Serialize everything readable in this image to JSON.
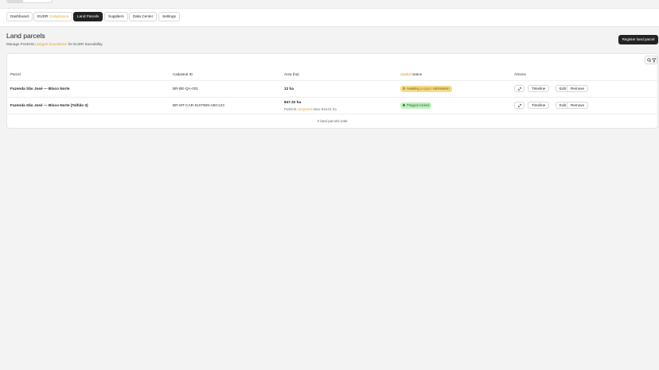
{
  "nav": {
    "dashboard": "Dashboard",
    "eudr_prefix": "EUDR",
    "eudr_highlight": "Compliance",
    "land_parcels": "Land Parcels",
    "suppliers": "Suppliers",
    "data_center": "Data Center",
    "settings": "Settings",
    "active": "Land Parcels"
  },
  "header": {
    "title": "Land parcels",
    "desc_prefix": "Manage PostGIS",
    "desc_highlight": "polygon boundaries",
    "desc_suffix": "for EUDR traceability.",
    "register_label": "Register land parcel"
  },
  "table": {
    "columns": {
      "parcel": "Parcel",
      "cadastral": "Cadastral ID",
      "area": "Area (ha)",
      "spatial_highlight": "Spatial",
      "spatial_rest": "status",
      "actions": "Actions"
    },
    "rows": [
      {
        "parcel": "Fazenda São José — Bloco Norte",
        "cadastral": "BR-BE-QA-001",
        "area": "12 ha",
        "status_prefix": "Awaiting",
        "status_highlight": "polygon",
        "status_suffix": "submission",
        "status_type": "warn"
      },
      {
        "parcel": "Fazenda São José — Bloco Norte (Talhão 3)",
        "cadastral": "BR-MT-CAR-5107909-ABC123",
        "area": "847.32 ha",
        "area_note_prefix": "PostGIS",
        "area_note_highlight": "computed",
        "area_note_suffix": "area: 844.01 ha",
        "status_label": "Polygon locked",
        "status_type": "ok"
      }
    ],
    "actions": {
      "timeline": "Timeline",
      "edit": "Edit",
      "remove": "Remove"
    },
    "footer": "2 land parcels total"
  },
  "colors": {
    "accent": "#e0a32a",
    "primary": "#232323",
    "warn_bg": "#f5dc8a",
    "ok_bg": "#c6efc4"
  }
}
